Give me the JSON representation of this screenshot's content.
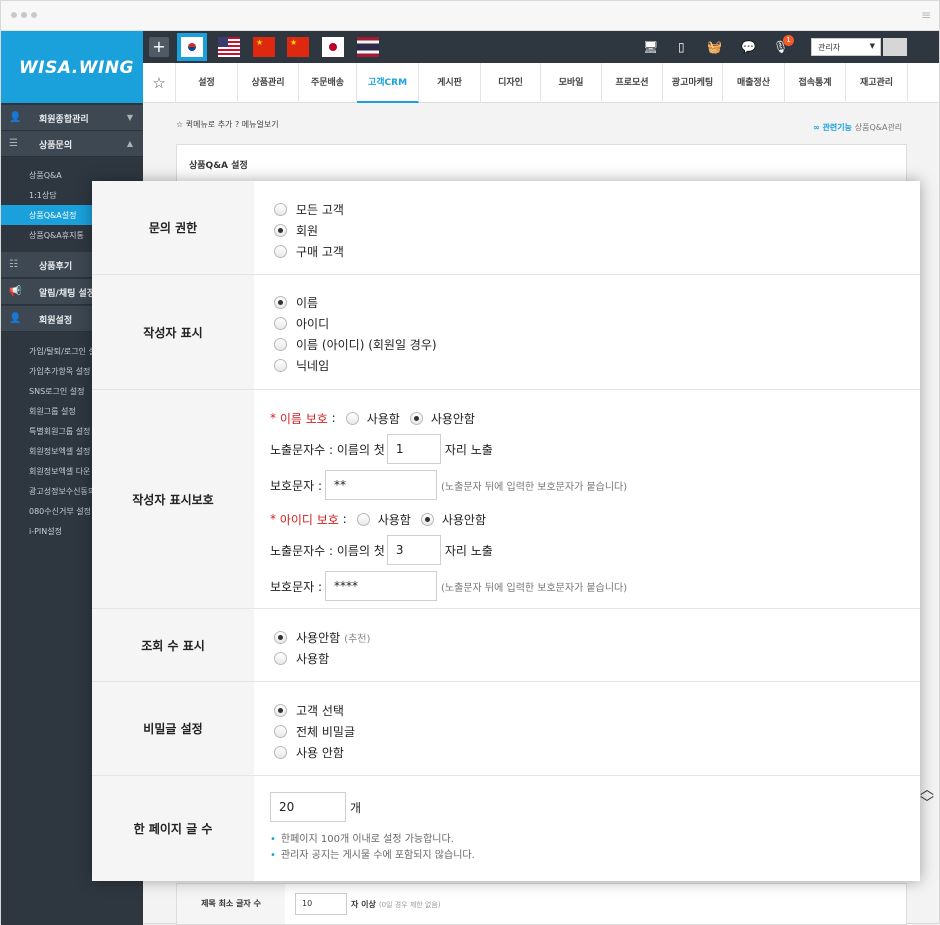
{
  "sidebar": {
    "logo": "WISA.WING",
    "sections": [
      {
        "label": "회원종합관리",
        "icon": "user-icon"
      },
      {
        "label": "상품문의",
        "icon": "list-icon"
      },
      {
        "label": "상품후기",
        "icon": "checklist-icon"
      },
      {
        "label": "알림/채팅 설정",
        "icon": "megaphone-icon"
      },
      {
        "label": "회원설정",
        "icon": "user-icon"
      }
    ],
    "inquiry_items": [
      "상품Q&A",
      "1:1상담",
      "상품Q&A설정",
      "상품Q&A휴지통"
    ],
    "member_items": [
      "가입/탈퇴/로그인 설",
      "가입추가항목 설정",
      "SNS로그인 설정",
      "회원그룹 설정",
      "특별회원그룹 설정",
      "회원정보엑셀 설정",
      "회원정보엑셀 다운",
      "광고성정보수신동의",
      "080수신거부 설정",
      "i-PIN설정"
    ]
  },
  "topbar": {
    "plus": "+",
    "admin_label": "관리자",
    "notification_count": "1"
  },
  "menubar": {
    "tabs": [
      "설정",
      "상품관리",
      "주문배송",
      "고객CRM",
      "게시판",
      "디자인",
      "모바일",
      "프로모션",
      "광고마케팅",
      "매출정산",
      "접속통계",
      "재고관리"
    ],
    "active_tab": "고객CRM"
  },
  "breadcrumb": {
    "add_quick": "퀵메뉴로 추가",
    "manual": "메뉴얼보기",
    "related_label": "관련기능",
    "related_link": "상품Q&A관리"
  },
  "page": {
    "section_title": "상품Q&A 설정"
  },
  "settings": {
    "inquiry_permission": {
      "label": "문의 권한",
      "options": [
        "모든 고객",
        "회원",
        "구매 고객"
      ],
      "selected": 1
    },
    "writer_display": {
      "label": "작성자 표시",
      "options": [
        "이름",
        "아이디",
        "이름 (아이디) (회원일 경우)",
        "닉네임"
      ],
      "selected": 0
    },
    "writer_protect": {
      "label": "작성자 표시보호",
      "name_protect_label": "이름 보호",
      "id_protect_label": "아이디 보호",
      "use_label": "사용함",
      "nouse_label": "사용안함",
      "star": "*",
      "colon": ":",
      "expose_prefix": "노출문자수 : 이름의 첫",
      "expose_suffix": "자리 노출",
      "protect_char_label": "보호문자 :",
      "hint": "(노출문자 뒤에 입력한 보호문자가 붙습니다)",
      "name_count": "1",
      "name_char": "**",
      "id_count": "3",
      "id_char": "****"
    },
    "view_count": {
      "label": "조회 수 표시",
      "options": [
        "사용안함",
        "사용함"
      ],
      "recommend": "(추천)",
      "selected": 0
    },
    "secret_post": {
      "label": "비밀글 설정",
      "options": [
        "고객 선택",
        "전체 비밀글",
        "사용 안함"
      ],
      "selected": 0
    },
    "posts_per_page": {
      "label": "한 페이지 글 수",
      "value": "20",
      "unit": "개",
      "notes": [
        "한페이지 100개 이내로 설정 가능합니다.",
        "관리자 공지는 게시물 수에 포함되지 않습니다."
      ]
    }
  },
  "bottom_row": {
    "label": "제목 최소 글자 수",
    "value": "10",
    "suffix": "자 이상",
    "note": "(0일 경우 제한 없음)"
  },
  "colors": {
    "accent": "#1aa1dc",
    "sidebar_bg": "#2e3740",
    "required": "#d21f1f"
  }
}
